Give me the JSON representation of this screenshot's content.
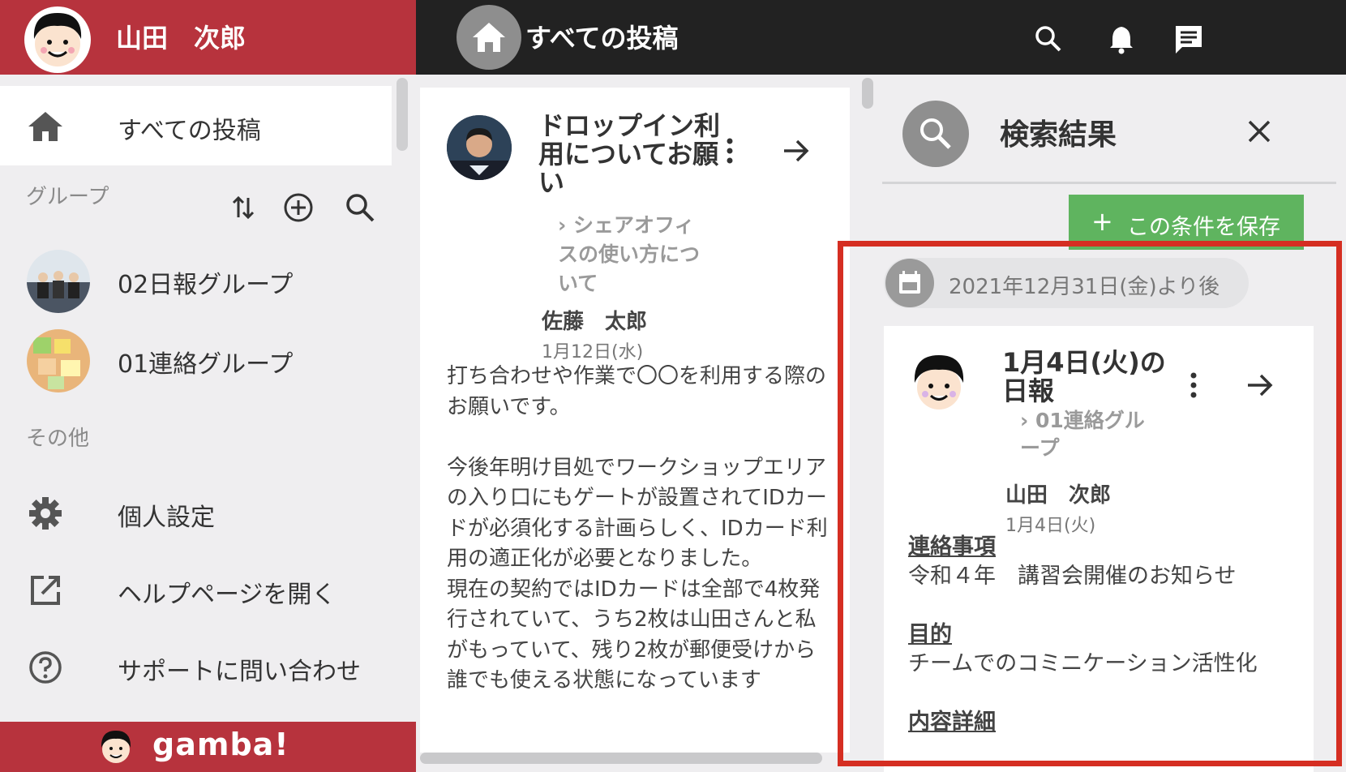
{
  "user": {
    "name": "山田　次郎"
  },
  "topbar": {
    "title": "すべての投稿",
    "icons": [
      "search-icon",
      "bell-icon",
      "message-icon"
    ]
  },
  "sidebar": {
    "active_item": {
      "label": "すべての投稿",
      "icon": "home-icon"
    },
    "groups_heading": "グループ",
    "group_tools": [
      "sort-icon",
      "add-circle-icon",
      "search-icon"
    ],
    "groups": [
      {
        "label": "02日報グループ"
      },
      {
        "label": "01連絡グループ"
      }
    ],
    "other_heading": "その他",
    "other_items": [
      {
        "label": "個人設定",
        "icon": "gear-icon"
      },
      {
        "label": "ヘルプページを開く",
        "icon": "external-link-icon"
      },
      {
        "label": "サポートに問い合わせ",
        "icon": "help-circle-icon"
      }
    ],
    "footer_logo": "gamba!"
  },
  "post": {
    "title": "ドロップイン利用についてお願い",
    "group": "› シェアオフィスの使い方について",
    "author": "佐藤　太郎",
    "date": "1月12日(水)",
    "body": "打ち合わせや作業で〇〇を利用する際のお願いです。\n\n今後年明け目処でワークショップエリアの入り口にもゲートが設置されてIDカードが必須化する計画らしく、IDカード利用の適正化が必要となりました。\n現在の契約ではIDカードは全部で4枚発行されていて、うち2枚は山田さんと私がもっていて、残り2枚が郵便受けから誰でも使える状態になっています"
  },
  "search_panel": {
    "title": "検索結果",
    "save_button": "この条件を保存",
    "filter_chip": "2021年12月31日(金)より後",
    "result": {
      "title": "1月4日(火)の日報",
      "group": "› 01連絡グループ",
      "author": "山田　次郎",
      "date": "1月4日(火)",
      "fields": [
        {
          "heading": "連絡事項",
          "value": "令和４年　講習会開催のお知らせ"
        },
        {
          "heading": "目的",
          "value": "チームでのコミニケーション活性化"
        },
        {
          "heading": "内容詳細",
          "value": ""
        }
      ]
    }
  },
  "colors": {
    "brand_red": "#b7333d",
    "topbar": "#222222",
    "save_green": "#5fb45f",
    "highlight": "#d52e22"
  }
}
